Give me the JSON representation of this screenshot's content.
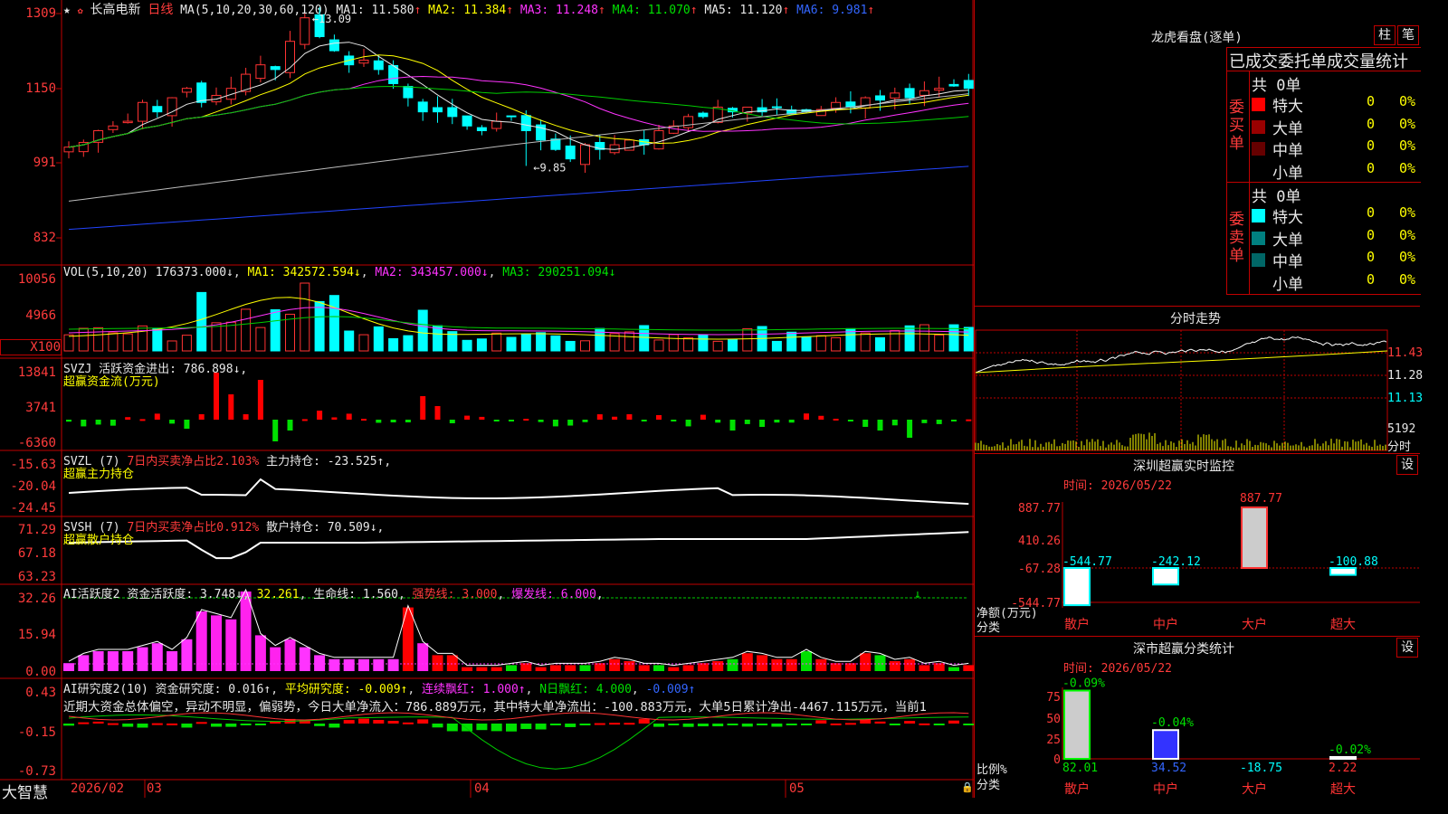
{
  "header": {
    "stock_name": "长高电新",
    "period": "日线",
    "ma_label": "MA(5,10,20,30,60,120)",
    "ma_values": [
      {
        "name": "MA1",
        "value": "11.580",
        "arrow": "↑",
        "color": "#e8e8e8"
      },
      {
        "name": "MA2",
        "value": "11.384",
        "arrow": "↑",
        "color": "#ffff00"
      },
      {
        "name": "MA3",
        "value": "11.248",
        "arrow": "↑",
        "color": "#ff33ff"
      },
      {
        "name": "MA4",
        "value": "11.070",
        "arrow": "↑",
        "color": "#00e000"
      },
      {
        "name": "MA5",
        "value": "11.120",
        "arrow": "↑",
        "color": "#e8e8e8"
      },
      {
        "name": "MA6",
        "value": "9.981",
        "arrow": "↑",
        "color": "#3366ff"
      }
    ],
    "high_note": "13.09",
    "low_note": "9.85"
  },
  "price_axis": [
    "1309",
    "1150",
    "991",
    "832"
  ],
  "vol": {
    "label": "VOL(5,10,20)",
    "value": "176373.000↓",
    "ma1": "MA1: 342572.594↓",
    "ma2": "MA2: 343457.000↓",
    "ma3": "MA3: 290251.094↓",
    "axis": [
      "10056",
      "4966",
      "X100"
    ]
  },
  "svzj": {
    "label": "SVZJ  活跃资金进出: 786.898↓,",
    "sub": "超赢资金流(万元)",
    "axis": [
      "13841",
      "3741",
      "-6360"
    ]
  },
  "svzl": {
    "label": "SVZL (7)",
    "pct": "7日内买卖净占比2.103%",
    "hold": "主力持仓: -23.525↑,",
    "sub": "超赢主力持仓",
    "axis": [
      "-15.63",
      "-20.04",
      "-24.45"
    ]
  },
  "svsh": {
    "label": "SVSH (7)",
    "pct": "7日内买卖净占比0.912%",
    "hold": "散户持仓: 70.509↓,",
    "sub": "超赢散户持仓",
    "axis": [
      "71.29",
      "67.18",
      "63.23"
    ]
  },
  "ai_active": {
    "label": "AI活跃度2",
    "v1": "资金活跃度: 3.748↓",
    "v2": "32.261",
    "v3": "生命线: 1.560",
    "v4": "强势线: 3.000",
    "v5": "爆发线: 6.000",
    "axis": [
      "32.26",
      "15.94",
      "0.00"
    ]
  },
  "ai_research": {
    "label": "AI研究度2(10)",
    "v1": "资金研究度: 0.016↑",
    "v2": "平均研究度: -0.009↑",
    "v3": "连续飘红: 1.000↑",
    "v4": "N日飘红: 4.000",
    "v5": "-0.009↑",
    "comment": "近期大资金总体偏空，异动不明显，偏弱势，今日大单净流入：786.889万元，其中特大单净流出：-100.883万元，大单5日累计净出-4467.115万元，当前1",
    "axis": [
      "0.43",
      "-0.15",
      "-0.73"
    ]
  },
  "bottom_axis": {
    "brand": "大智慧",
    "labels": [
      "2026/02",
      "03",
      "04",
      "05"
    ]
  },
  "right": {
    "lhb_title": "龙虎看盘(逐单)",
    "btn_zhu": "柱",
    "btn_bi": "笔",
    "order_title": "已成交委托单成交量统计",
    "buy": {
      "side": "委买单",
      "total": "共 0单",
      "rows": [
        {
          "name": "特大",
          "count": "0",
          "pct": "0%",
          "color": "#ff0000"
        },
        {
          "name": "大单",
          "count": "0",
          "pct": "0%",
          "color": "#990000"
        },
        {
          "name": "中单",
          "count": "0",
          "pct": "0%",
          "color": "#660000"
        },
        {
          "name": "小单",
          "count": "0",
          "pct": "0%",
          "color": "#000000"
        }
      ]
    },
    "sell": {
      "side": "委卖单",
      "total": "共 0单",
      "rows": [
        {
          "name": "特大",
          "count": "0",
          "pct": "0%",
          "color": "#00ffff"
        },
        {
          "name": "大单",
          "count": "0",
          "pct": "0%",
          "color": "#008080"
        },
        {
          "name": "中单",
          "count": "0",
          "pct": "0%",
          "color": "#006666"
        },
        {
          "name": "小单",
          "count": "0",
          "pct": "0%",
          "color": "#000000"
        }
      ]
    },
    "intraday_title": "分时走势",
    "intraday_axis": [
      "11.43",
      "11.28",
      "11.13",
      "5192",
      "分时"
    ],
    "monitor": {
      "title": "深圳超赢实时监控",
      "btn": "设",
      "time": "时间: 2026/05/22",
      "axis": [
        "887.77",
        "410.26",
        "-67.28",
        "-544.77"
      ],
      "unit1": "净额(万元)",
      "unit2": "分类",
      "cats": [
        "散户",
        "中户",
        "大户",
        "超大"
      ],
      "values": [
        -544.77,
        -242.12,
        887.77,
        -100.88
      ],
      "labels": [
        "-544.77",
        "-242.12",
        "887.77",
        "-100.88"
      ]
    },
    "classify": {
      "title": "深市超赢分类统计",
      "btn": "设",
      "time": "时间: 2026/05/22",
      "axis": [
        "75",
        "50",
        "25",
        "0"
      ],
      "unit1": "比例%",
      "unit2": "分类",
      "cats": [
        "散户",
        "中户",
        "大户",
        "超大"
      ],
      "values": [
        82.01,
        34.52,
        -18.75,
        2.22
      ],
      "labels": [
        "82.01",
        "34.52",
        "-18.75",
        "2.22"
      ],
      "top_labels": [
        "-0.09%",
        "-0.04%",
        "",
        "-0.02%"
      ]
    }
  },
  "chart_data": {
    "type": "candlestick",
    "xlabel": "",
    "ylabel": "",
    "x_labels": [
      "2026/02",
      "03",
      "04",
      "05"
    ],
    "price_range": [
      8.32,
      13.09
    ],
    "high": 13.09,
    "low": 9.85,
    "ma_last": {
      "MA1": 11.58,
      "MA2": 11.384,
      "MA3": 11.248,
      "MA4": 11.07,
      "MA5": 11.12,
      "MA6": 9.981
    }
  }
}
